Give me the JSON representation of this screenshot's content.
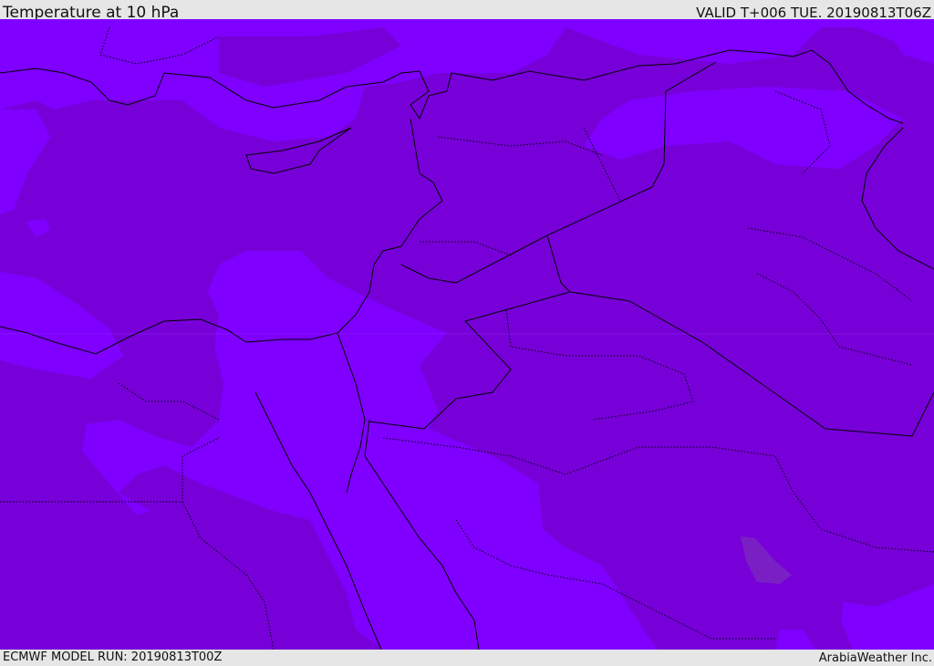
{
  "header": {
    "title": "Temperature at 10 hPa",
    "valid": "VALID T+006 TUE. 20190813T06Z"
  },
  "footer": {
    "model_run": "ECMWF MODEL RUN: 20190813T00Z",
    "credit": "ArabiaWeather Inc."
  },
  "colors": {
    "dark_fill": "#7700d9",
    "light_fill": "#7f00ff",
    "spot_fill": "#7a1fc4",
    "border": "#000000"
  }
}
